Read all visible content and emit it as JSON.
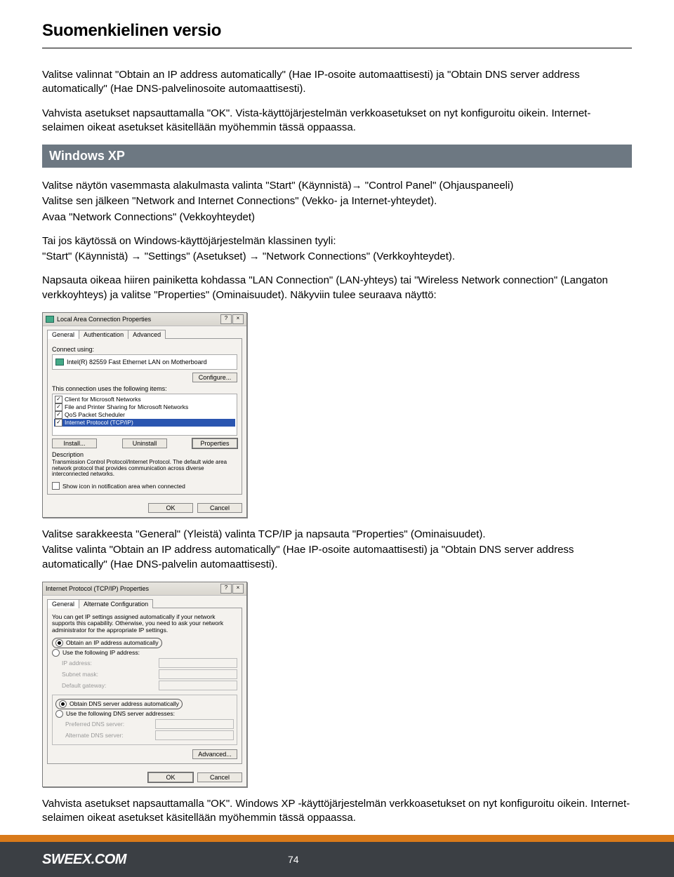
{
  "title": "Suomenkielinen versio",
  "intro": {
    "p1": "Valitse valinnat \"Obtain an IP address automatically\" (Hae IP-osoite automaattisesti) ja \"Obtain DNS server address automatically\" (Hae DNS-palvelinosoite automaattisesti).",
    "p2": "Vahvista asetukset napsauttamalla \"OK\". Vista-käyttöjärjestelmän verkkoasetukset on nyt konfiguroitu oikein. Internet-selaimen oikeat asetukset käsitellään myöhemmin tässä oppaassa."
  },
  "section_header": "Windows XP",
  "xp": {
    "p1a": "Valitse näytön vasemmasta alakulmasta valinta \"Start\" (Käynnistä)",
    "p1b": " \"Control Panel\" (Ohjauspaneeli)",
    "p2": "Valitse sen jälkeen \"Network and Internet Connections\" (Vekko- ja Internet-yhteydet).",
    "p3": "Avaa \"Network Connections\" (Vekkoyhteydet)",
    "p4": "Tai jos käytössä on Windows-käyttöjärjestelmän klassinen tyyli:",
    "p5a": "\"Start\" (Käynnistä) ",
    "p5b": " \"Settings\" (Asetukset) ",
    "p5c": " \"Network Connections\" (Verkkoyhteydet).",
    "p6": "Napsauta oikeaa hiiren painiketta kohdassa \"LAN Connection\" (LAN-yhteys) tai \"Wireless Network connection\" (Langaton verkkoyhteys) ja valitse \"Properties\" (Ominaisuudet). Näkyviin tulee seuraava näyttö:"
  },
  "dlg1": {
    "title": "Local Area Connection Properties",
    "tab_general": "General",
    "tab_auth": "Authentication",
    "tab_adv": "Advanced",
    "connect_using": "Connect using:",
    "adapter": "Intel(R) 82559 Fast Ethernet LAN on Motherboard",
    "configure": "Configure...",
    "uses_items": "This connection uses the following items:",
    "item1": "Client for Microsoft Networks",
    "item2": "File and Printer Sharing for Microsoft Networks",
    "item3": "QoS Packet Scheduler",
    "item4": "Internet Protocol (TCP/IP)",
    "install": "Install...",
    "uninstall": "Uninstall",
    "properties": "Properties",
    "desc_label": "Description",
    "desc": "Transmission Control Protocol/Internet Protocol. The default wide area network protocol that provides communication across diverse interconnected networks.",
    "show_icon": "Show icon in notification area when connected",
    "ok": "OK",
    "cancel": "Cancel"
  },
  "mid": {
    "p1": "Valitse sarakkeesta \"General\" (Yleistä) valinta TCP/IP ja napsauta \"Properties\" (Ominaisuudet).",
    "p2": "Valitse valinta \"Obtain an IP address automatically\" (Hae IP-osoite automaattisesti) ja \"Obtain DNS server address automatically\" (Hae DNS-palvelin automaattisesti)."
  },
  "dlg2": {
    "title": "Internet Protocol (TCP/IP) Properties",
    "tab_general": "General",
    "tab_alt": "Alternate Configuration",
    "blurb": "You can get IP settings assigned automatically if your network supports this capability. Otherwise, you need to ask your network administrator for the appropriate IP settings.",
    "r_auto_ip": "Obtain an IP address automatically",
    "r_use_ip": "Use the following IP address:",
    "ip": "IP address:",
    "subnet": "Subnet mask:",
    "gateway": "Default gateway:",
    "r_auto_dns": "Obtain DNS server address automatically",
    "r_use_dns": "Use the following DNS server addresses:",
    "pref_dns": "Preferred DNS server:",
    "alt_dns": "Alternate DNS server:",
    "advanced": "Advanced...",
    "ok": "OK",
    "cancel": "Cancel"
  },
  "closing": "Vahvista asetukset napsauttamalla \"OK\". Windows XP -käyttöjärjestelmän verkkoasetukset on nyt konfiguroitu oikein. Internet-selaimen oikeat asetukset käsitellään myöhemmin tässä oppaassa.",
  "footer": {
    "site": "SWEEX.COM",
    "page": "74"
  }
}
